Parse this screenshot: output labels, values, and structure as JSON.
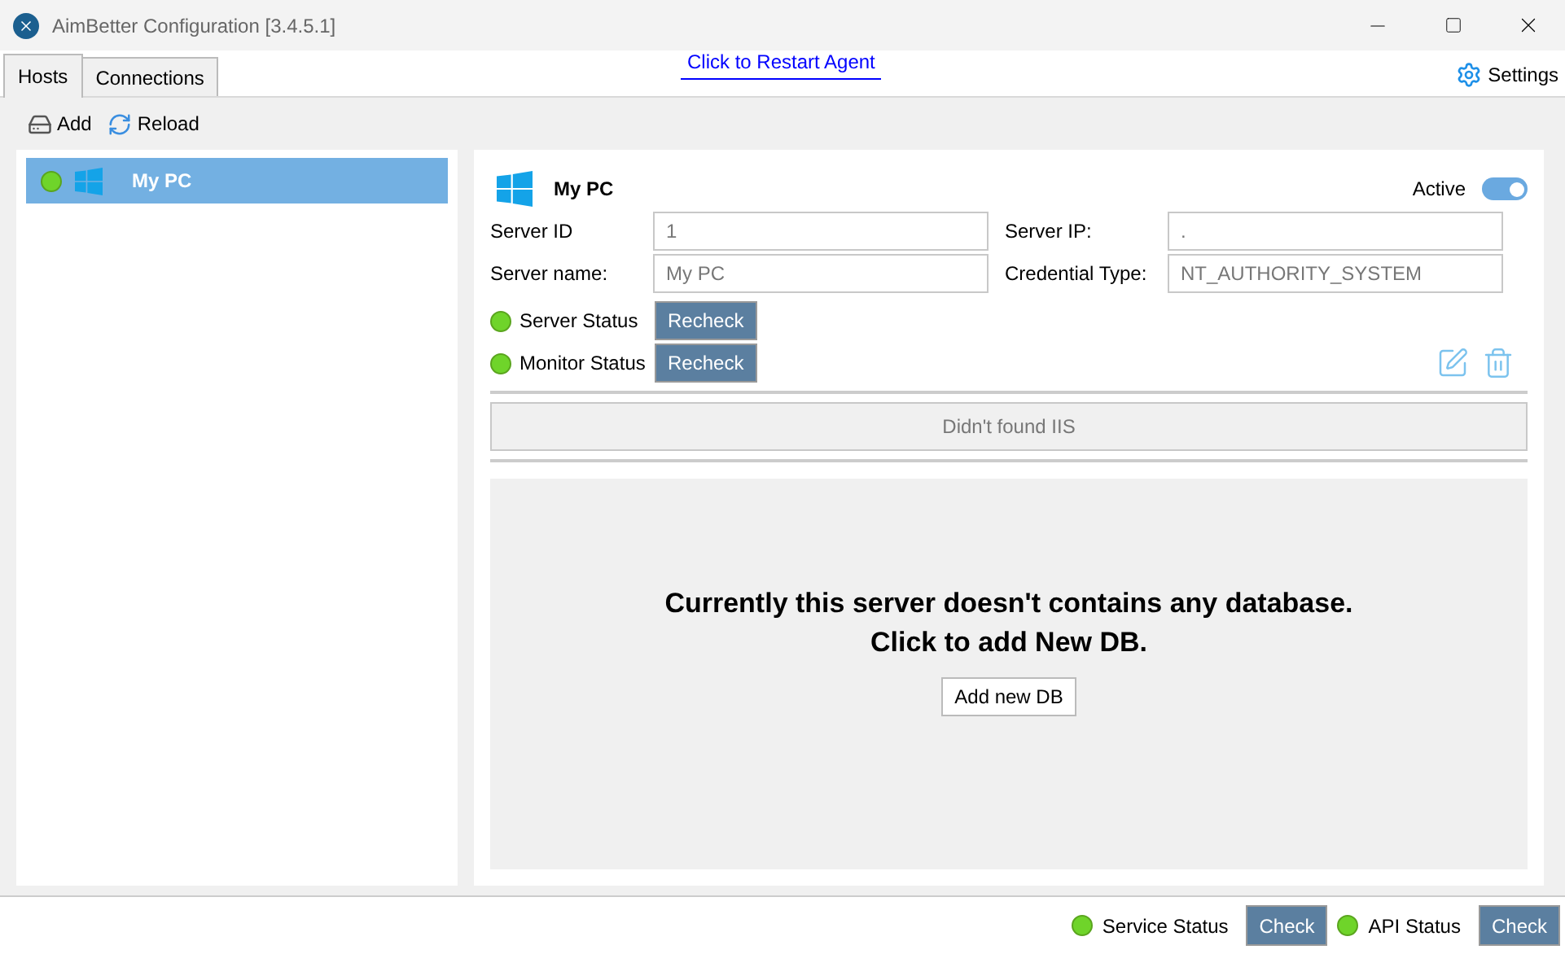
{
  "window": {
    "title": "AimBetter Configuration [3.4.5.1]"
  },
  "tabs": [
    {
      "label": "Hosts",
      "selected": true
    },
    {
      "label": "Connections",
      "selected": false
    }
  ],
  "restart_link": "Click to Restart Agent",
  "settings": "Settings",
  "toolbar": [
    {
      "label": "Add",
      "kind": "add"
    },
    {
      "label": "Reload",
      "kind": "reload"
    }
  ],
  "hosts": [
    {
      "name": "My PC",
      "selected": true,
      "color": "#6fd42a"
    }
  ],
  "server": {
    "name": "My PC",
    "active_label": "Active",
    "active": true,
    "fields": [
      {
        "label": "Server ID",
        "value": "1"
      },
      {
        "label": "Server IP:",
        "value": "."
      },
      {
        "label": "Server name:",
        "value": "My PC"
      },
      {
        "label": "Credential Type:",
        "value": "NT_AUTHORITY_SYSTEM"
      }
    ],
    "statuses": [
      {
        "label": "Server Status",
        "button": "Recheck",
        "color": "#6fd42a"
      },
      {
        "label": "Monitor Status",
        "button": "Recheck",
        "color": "#6fd42a"
      }
    ],
    "iis_button": "Didn't found IIS",
    "empty_message": [
      "Currently this server doesn't contains any database.",
      "Click to add New DB."
    ],
    "add_db_button": "Add new DB"
  },
  "status_bar": [
    {
      "label": "Service Status",
      "button": "Check",
      "color": "#6fd42a"
    },
    {
      "label": "API Status",
      "button": "Check",
      "color": "#6fd42a"
    }
  ]
}
